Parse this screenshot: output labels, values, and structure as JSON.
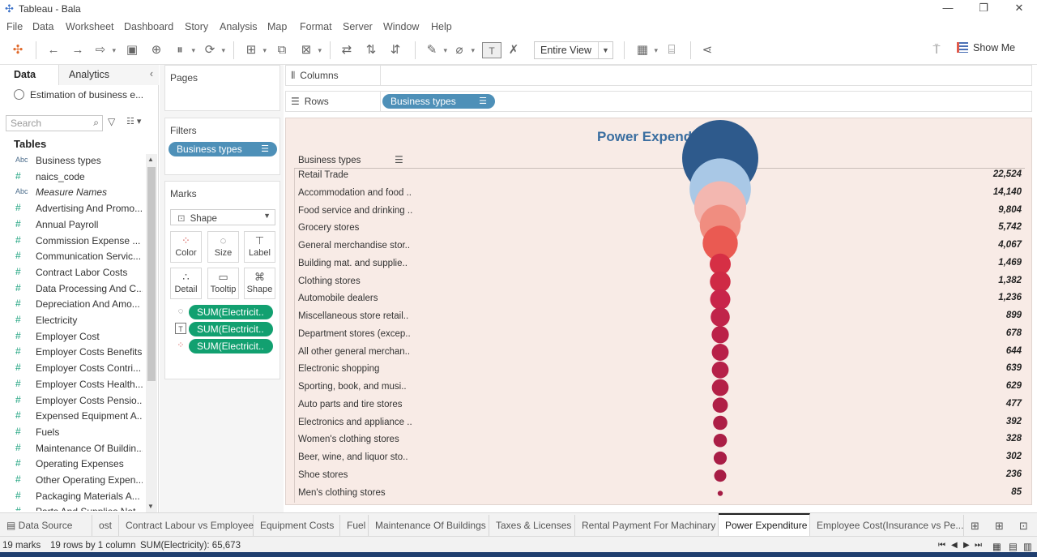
{
  "window": {
    "title": "Tableau - Bala"
  },
  "menu": [
    "File",
    "Data",
    "Worksheet",
    "Dashboard",
    "Story",
    "Analysis",
    "Map",
    "Format",
    "Server",
    "Window",
    "Help"
  ],
  "toolbar": {
    "view_mode": "Entire View",
    "show_me": "Show Me"
  },
  "datapane": {
    "tab_data": "Data",
    "tab_analytics": "Analytics",
    "datasource": "Estimation of business e...",
    "search_placeholder": "Search",
    "tables_heading": "Tables",
    "fields": [
      {
        "type": "Abc",
        "name": "Business types"
      },
      {
        "type": "#",
        "name": "naics_code"
      },
      {
        "type": "Abc",
        "name": "Measure Names",
        "italic": true
      },
      {
        "type": "#",
        "name": "Advertising And Promo..."
      },
      {
        "type": "#",
        "name": "Annual Payroll"
      },
      {
        "type": "#",
        "name": "Commission Expense ..."
      },
      {
        "type": "#",
        "name": "Communication Servic..."
      },
      {
        "type": "#",
        "name": "Contract Labor Costs"
      },
      {
        "type": "#",
        "name": "Data Processing And C..."
      },
      {
        "type": "#",
        "name": "Depreciation And Amo..."
      },
      {
        "type": "#",
        "name": "Electricity"
      },
      {
        "type": "#",
        "name": "Employer Cost"
      },
      {
        "type": "#",
        "name": "Employer Costs Benefits"
      },
      {
        "type": "#",
        "name": "Employer Costs Contri..."
      },
      {
        "type": "#",
        "name": "Employer Costs Health..."
      },
      {
        "type": "#",
        "name": "Employer Costs Pensio..."
      },
      {
        "type": "#",
        "name": "Expensed Equipment A..."
      },
      {
        "type": "#",
        "name": "Fuels"
      },
      {
        "type": "#",
        "name": "Maintenance Of Buildin..."
      },
      {
        "type": "#",
        "name": "Operating Expenses"
      },
      {
        "type": "#",
        "name": "Other Operating Expen..."
      },
      {
        "type": "#",
        "name": "Packaging Materials A..."
      },
      {
        "type": "#",
        "name": "Parts And Supplies Not..."
      }
    ]
  },
  "shelves": {
    "pages": "Pages",
    "filters": "Filters",
    "filter_pill": "Business types",
    "marks": "Marks",
    "mark_type": "Shape",
    "mark_buttons": [
      "Color",
      "Size",
      "Label",
      "Detail",
      "Tooltip",
      "Shape"
    ],
    "mark_pills": [
      "SUM(Electricit..",
      "SUM(Electricit..",
      "SUM(Electricit.."
    ],
    "columns": "Columns",
    "rows": "Rows",
    "rows_pill": "Business types"
  },
  "viz": {
    "title": "Power Expenditure",
    "row_header": "Business types"
  },
  "chart_data": {
    "type": "scatter",
    "title": "Power Expenditure",
    "dimension": "Business types",
    "measure": "SUM(Electricity)",
    "categories": [
      "Retail Trade",
      "Accommodation and food ..",
      "Food service and drinking ..",
      "Grocery stores",
      "General merchandise stor..",
      "Building mat. and supplie..",
      "Clothing stores",
      "Automobile dealers",
      "Miscellaneous store retail..",
      "Department stores (excep..",
      "All other general merchan..",
      "Electronic shopping",
      "Sporting, book, and  musi..",
      "Auto parts and tire stores",
      "Electronics and appliance ..",
      "Women's clothing stores",
      "Beer, wine, and liquor sto..",
      "Shoe stores",
      "Men's clothing stores"
    ],
    "labels": [
      "22,524",
      "14,140",
      "9,804",
      "5,742",
      "4,067",
      "1,469",
      "1,382",
      "1,236",
      "899",
      "678",
      "644",
      "639",
      "629",
      "477",
      "392",
      "328",
      "302",
      "236",
      "85"
    ],
    "values": [
      22524,
      14140,
      9804,
      5742,
      4067,
      1469,
      1382,
      1236,
      899,
      678,
      644,
      639,
      629,
      477,
      392,
      328,
      302,
      236,
      85
    ],
    "colors": [
      "#2e5a8c",
      "#a9c8e6",
      "#f3b7b0",
      "#f08d80",
      "#ea5a52",
      "#d62f45",
      "#cf2a45",
      "#c8254a",
      "#c0244a",
      "#bb2148",
      "#b82048",
      "#b62048",
      "#b42047",
      "#b01f47",
      "#ad1e46",
      "#ab1e46",
      "#a91d46",
      "#a71d45",
      "#a51c45"
    ]
  },
  "sheet_tabs": [
    "Data Source",
    "ost",
    "Contract Labour vs Employee",
    "Equipment Costs",
    "Fuel",
    "Maintenance Of Buildings",
    "Taxes & Licenses",
    "Rental Payment For Machinary",
    "Power Expenditure",
    "Employee Cost(Insurance vs Pe..."
  ],
  "status": {
    "marks": "19 marks",
    "rows": "19 rows by 1 column",
    "sum": "SUM(Electricity): 65,673"
  }
}
